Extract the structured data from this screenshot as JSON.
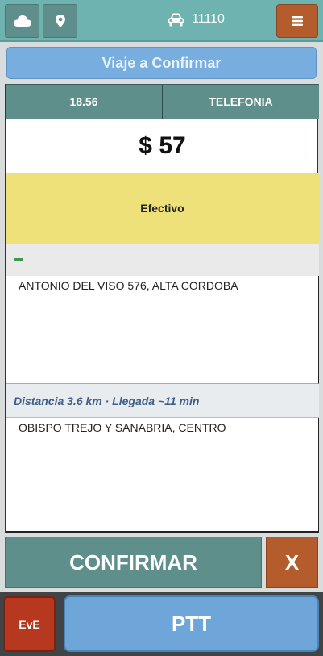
{
  "topbar": {
    "cloud_icon": "cloud-icon",
    "location_icon": "map-pin-icon",
    "car_icon": "car-icon",
    "vehicle_number": "11110",
    "menu_icon": "hamburger-menu-icon"
  },
  "banner": {
    "label": "Viaje a Confirmar"
  },
  "trip": {
    "time": "18.56",
    "source": "TELEFONIA",
    "price": "$ 57",
    "payment": "Efectivo",
    "origin": "ANTONIO DEL VISO 576, ALTA CORDOBA",
    "distance": "Distancia 3.6 km · Llegada ~11 min",
    "destination": "OBISPO TREJO Y SANABRIA, CENTRO"
  },
  "actions": {
    "confirm_label": "CONFIRMAR",
    "cancel_label": "X"
  },
  "footer": {
    "eve_label": "EvE",
    "ptt_label": "PTT"
  },
  "colors": {
    "topbar": "#6fb3b1",
    "teal": "#5f8f8a",
    "orange": "#b45c2c",
    "blue": "#78ade0",
    "yellow": "#efe17a",
    "red": "#b5381f"
  }
}
